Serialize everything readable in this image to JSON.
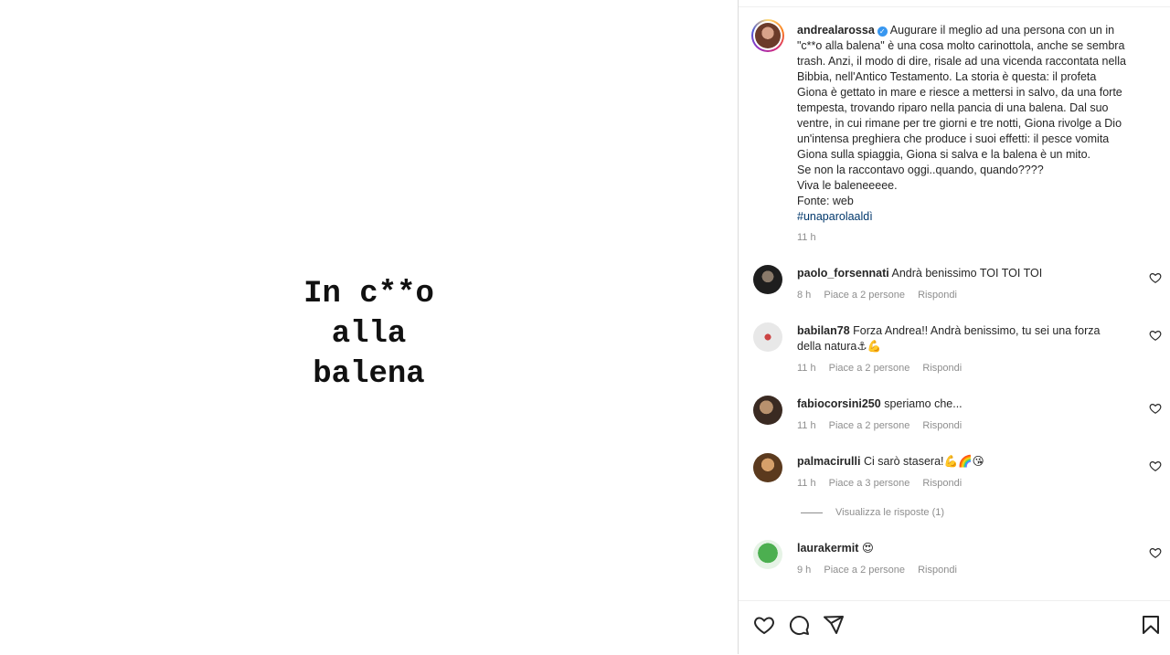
{
  "post_image": {
    "text": "In c**o\nalla\nbalena"
  },
  "caption": {
    "username": "andrealarossa",
    "lines": [
      "Augurare il meglio ad una persona con un in",
      "\"c**o alla balena\" è una cosa molto carinottola, anche se sembra",
      "trash. Anzi, il modo di dire, risale ad una vicenda raccontata nella",
      "Bibbia, nell'Antico Testamento. La storia è questa: il profeta",
      "Giona è gettato in mare e riesce a mettersi in salvo, da una forte",
      "tempesta, trovando riparo nella pancia di una balena. Dal suo",
      "ventre, in cui rimane per tre giorni e tre notti, Giona rivolge a Dio",
      "un'intensa preghiera che produce i suoi effetti: il pesce vomita",
      "Giona sulla spiaggia, Giona si salva e la balena è un mito.",
      "Se non la raccontavo oggi..quando, quando????",
      "Viva le baleneeeee.",
      "Fonte: web"
    ],
    "hashtag": "#unaparolaaldì",
    "time": "11 h"
  },
  "comments": [
    {
      "username": "paolo_forsennati",
      "text": "Andrà benissimo TOI TOI TOI",
      "time": "8 h",
      "likes": "Piace a 2 persone",
      "reply": "Rispondi"
    },
    {
      "username": "babilan78",
      "text": "Forza Andrea!! Andrà benissimo, tu sei una forza",
      "text2": "della natura⚓💪",
      "time": "11 h",
      "likes": "Piace a 2 persone",
      "reply": "Rispondi"
    },
    {
      "username": "fabiocorsini250",
      "text": "speriamo che...",
      "time": "11 h",
      "likes": "Piace a 2 persone",
      "reply": "Rispondi"
    },
    {
      "username": "palmacirulli",
      "text": "Ci sarò stasera!💪🌈😘",
      "time": "11 h",
      "likes": "Piace a 3 persone",
      "reply": "Rispondi"
    },
    {
      "username": "laurakermit",
      "text": "😍",
      "time": "9 h",
      "likes": "Piace a 2 persone",
      "reply": "Rispondi"
    }
  ],
  "view_replies": "Visualizza le risposte (1)"
}
